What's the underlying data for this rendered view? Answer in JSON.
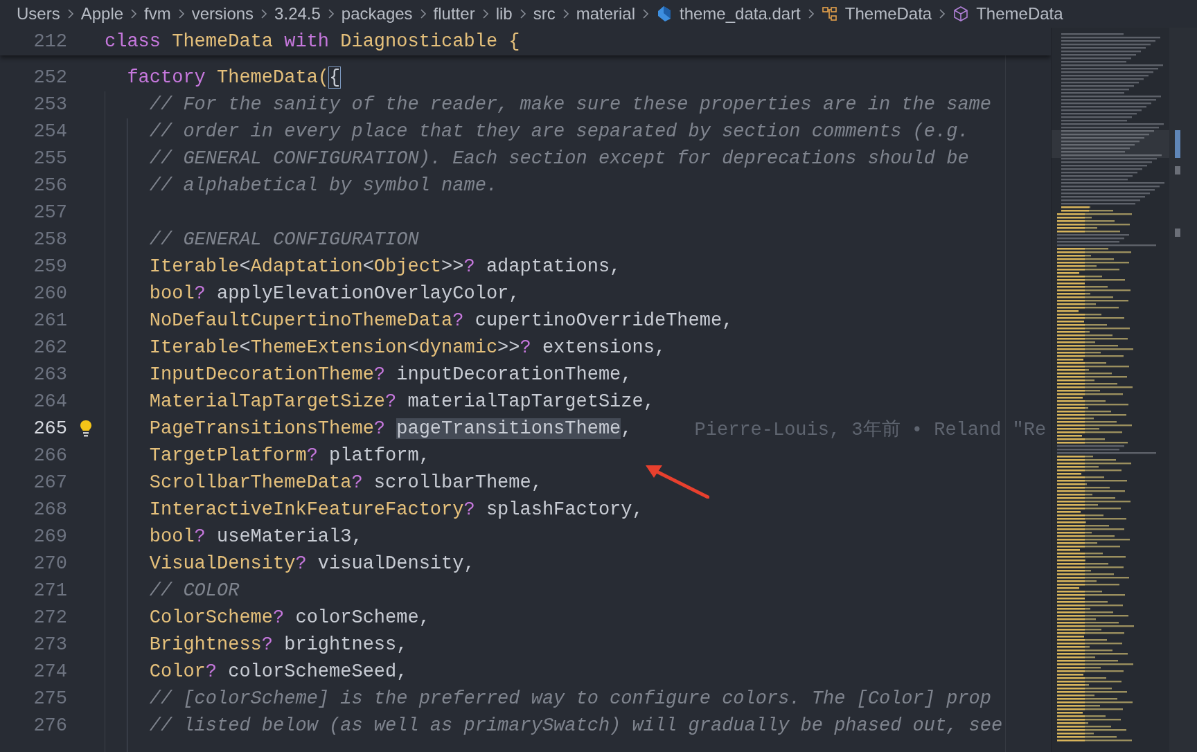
{
  "breadcrumb": [
    {
      "kind": "folder",
      "label": "Users"
    },
    {
      "kind": "folder",
      "label": "Apple"
    },
    {
      "kind": "folder",
      "label": "fvm"
    },
    {
      "kind": "folder",
      "label": "versions"
    },
    {
      "kind": "folder",
      "label": "3.24.5"
    },
    {
      "kind": "folder",
      "label": "packages"
    },
    {
      "kind": "folder",
      "label": "flutter"
    },
    {
      "kind": "folder",
      "label": "lib"
    },
    {
      "kind": "folder",
      "label": "src"
    },
    {
      "kind": "folder",
      "label": "material"
    },
    {
      "kind": "file",
      "label": "theme_data.dart"
    },
    {
      "kind": "class",
      "label": "ThemeData"
    },
    {
      "kind": "constructor",
      "label": "ThemeData"
    }
  ],
  "sticky_line": {
    "number": "212",
    "tokens": [
      {
        "kind": "keyword",
        "text": "class "
      },
      {
        "kind": "type",
        "text": "ThemeData "
      },
      {
        "kind": "keyword",
        "text": "with "
      },
      {
        "kind": "type",
        "text": "Diagnosticable "
      },
      {
        "kind": "type",
        "text": "{"
      }
    ]
  },
  "lines": [
    {
      "number": "252",
      "current": false,
      "lightbulb": false,
      "tokens": [
        {
          "kind": "keyword",
          "text": "factory "
        },
        {
          "kind": "type",
          "text": "ThemeData("
        },
        {
          "kind": "bracket_match",
          "text": "{"
        }
      ],
      "children": [
        {
          "number": "253",
          "current": false,
          "lightbulb": false,
          "tokens": [
            {
              "kind": "comment",
              "text": "// For the sanity of the reader, make sure these properties are in the same"
            }
          ]
        },
        {
          "number": "254",
          "current": false,
          "lightbulb": false,
          "tokens": [
            {
              "kind": "comment",
              "text": "// order in every place that they are separated by section comments (e.g."
            }
          ]
        },
        {
          "number": "255",
          "current": false,
          "lightbulb": false,
          "tokens": [
            {
              "kind": "comment",
              "text": "// GENERAL CONFIGURATION). Each section except for deprecations should be"
            }
          ]
        },
        {
          "number": "256",
          "current": false,
          "lightbulb": false,
          "tokens": [
            {
              "kind": "comment",
              "text": "// alphabetical by symbol name."
            }
          ]
        },
        {
          "number": "257",
          "current": false,
          "lightbulb": false
        },
        {
          "number": "258",
          "current": false,
          "lightbulb": false,
          "tokens": [
            {
              "kind": "comment",
              "text": "// GENERAL CONFIGURATION"
            }
          ]
        },
        {
          "number": "259",
          "current": false,
          "lightbulb": false,
          "tokens": [
            {
              "kind": "type",
              "text": "Iterable"
            },
            {
              "kind": "plain",
              "text": "<"
            },
            {
              "kind": "type",
              "text": "Adaptation"
            },
            {
              "kind": "plain",
              "text": "<"
            },
            {
              "kind": "type",
              "text": "Object"
            },
            {
              "kind": "plain",
              "text": ">>"
            },
            {
              "kind": "keyword",
              "text": "? "
            },
            {
              "kind": "plain",
              "text": "adaptations,"
            }
          ]
        },
        {
          "number": "260",
          "current": false,
          "lightbulb": false,
          "tokens": [
            {
              "kind": "type",
              "text": "bool"
            },
            {
              "kind": "keyword",
              "text": "? "
            },
            {
              "kind": "plain",
              "text": "applyElevationOverlayColor,"
            }
          ]
        },
        {
          "number": "261",
          "current": false,
          "lightbulb": false,
          "tokens": [
            {
              "kind": "type",
              "text": "NoDefaultCupertinoThemeData"
            },
            {
              "kind": "keyword",
              "text": "? "
            },
            {
              "kind": "plain",
              "text": "cupertinoOverrideTheme,"
            }
          ]
        },
        {
          "number": "262",
          "current": false,
          "lightbulb": false,
          "tokens": [
            {
              "kind": "type",
              "text": "Iterable"
            },
            {
              "kind": "plain",
              "text": "<"
            },
            {
              "kind": "type",
              "text": "ThemeExtension"
            },
            {
              "kind": "plain",
              "text": "<"
            },
            {
              "kind": "type",
              "text": "dynamic"
            },
            {
              "kind": "plain",
              "text": ">>"
            },
            {
              "kind": "keyword",
              "text": "? "
            },
            {
              "kind": "plain",
              "text": "extensions,"
            }
          ]
        },
        {
          "number": "263",
          "current": false,
          "lightbulb": false,
          "tokens": [
            {
              "kind": "type",
              "text": "InputDecorationTheme"
            },
            {
              "kind": "keyword",
              "text": "? "
            },
            {
              "kind": "plain",
              "text": "inputDecorationTheme,"
            }
          ]
        },
        {
          "number": "264",
          "current": false,
          "lightbulb": false,
          "tokens": [
            {
              "kind": "type",
              "text": "MaterialTapTargetSize"
            },
            {
              "kind": "keyword",
              "text": "? "
            },
            {
              "kind": "plain",
              "text": "materialTapTargetSize,"
            }
          ]
        },
        {
          "number": "265",
          "current": true,
          "lightbulb": true,
          "tokens": [
            {
              "kind": "type",
              "text": "PageTransitionsTheme"
            },
            {
              "kind": "keyword",
              "text": "? "
            },
            {
              "kind": "plain",
              "text": "pageTransitionsTheme",
              "selected": true
            },
            {
              "kind": "plain",
              "text": ","
            }
          ],
          "blame": "Pierre-Louis, 3年前 • Reland \"Re"
        },
        {
          "number": "266",
          "current": false,
          "lightbulb": false,
          "tokens": [
            {
              "kind": "type",
              "text": "TargetPlatform"
            },
            {
              "kind": "keyword",
              "text": "? "
            },
            {
              "kind": "plain",
              "text": "platform,"
            }
          ]
        },
        {
          "number": "267",
          "current": false,
          "lightbulb": false,
          "tokens": [
            {
              "kind": "type",
              "text": "ScrollbarThemeData"
            },
            {
              "kind": "keyword",
              "text": "? "
            },
            {
              "kind": "plain",
              "text": "scrollbarTheme,"
            }
          ]
        },
        {
          "number": "268",
          "current": false,
          "lightbulb": false,
          "tokens": [
            {
              "kind": "type",
              "text": "InteractiveInkFeatureFactory"
            },
            {
              "kind": "keyword",
              "text": "? "
            },
            {
              "kind": "plain",
              "text": "splashFactory,"
            }
          ]
        },
        {
          "number": "269",
          "current": false,
          "lightbulb": false,
          "tokens": [
            {
              "kind": "type",
              "text": "bool"
            },
            {
              "kind": "keyword",
              "text": "? "
            },
            {
              "kind": "plain",
              "text": "useMaterial3,"
            }
          ]
        },
        {
          "number": "270",
          "current": false,
          "lightbulb": false,
          "tokens": [
            {
              "kind": "type",
              "text": "VisualDensity"
            },
            {
              "kind": "keyword",
              "text": "? "
            },
            {
              "kind": "plain",
              "text": "visualDensity,"
            }
          ]
        },
        {
          "number": "271",
          "current": false,
          "lightbulb": false,
          "tokens": [
            {
              "kind": "comment",
              "text": "// COLOR"
            }
          ]
        },
        {
          "number": "272",
          "current": false,
          "lightbulb": false,
          "tokens": [
            {
              "kind": "type",
              "text": "ColorScheme"
            },
            {
              "kind": "keyword",
              "text": "? "
            },
            {
              "kind": "plain",
              "text": "colorScheme,"
            }
          ]
        },
        {
          "number": "273",
          "current": false,
          "lightbulb": false,
          "tokens": [
            {
              "kind": "type",
              "text": "Brightness"
            },
            {
              "kind": "keyword",
              "text": "? "
            },
            {
              "kind": "plain",
              "text": "brightness,"
            }
          ]
        },
        {
          "number": "274",
          "current": false,
          "lightbulb": false,
          "tokens": [
            {
              "kind": "type",
              "text": "Color"
            },
            {
              "kind": "keyword",
              "text": "? "
            },
            {
              "kind": "plain",
              "text": "colorSchemeSeed,"
            }
          ]
        },
        {
          "number": "275",
          "current": false,
          "lightbulb": false,
          "tokens": [
            {
              "kind": "comment",
              "text": "// [colorScheme] is the preferred way to configure colors. The [Color] prop"
            }
          ]
        },
        {
          "number": "276",
          "current": false,
          "lightbulb": false,
          "tokens": [
            {
              "kind": "comment",
              "text": "// listed below (as well as primarySwatch) will gradually be phased out, see"
            }
          ]
        }
      ]
    }
  ]
}
